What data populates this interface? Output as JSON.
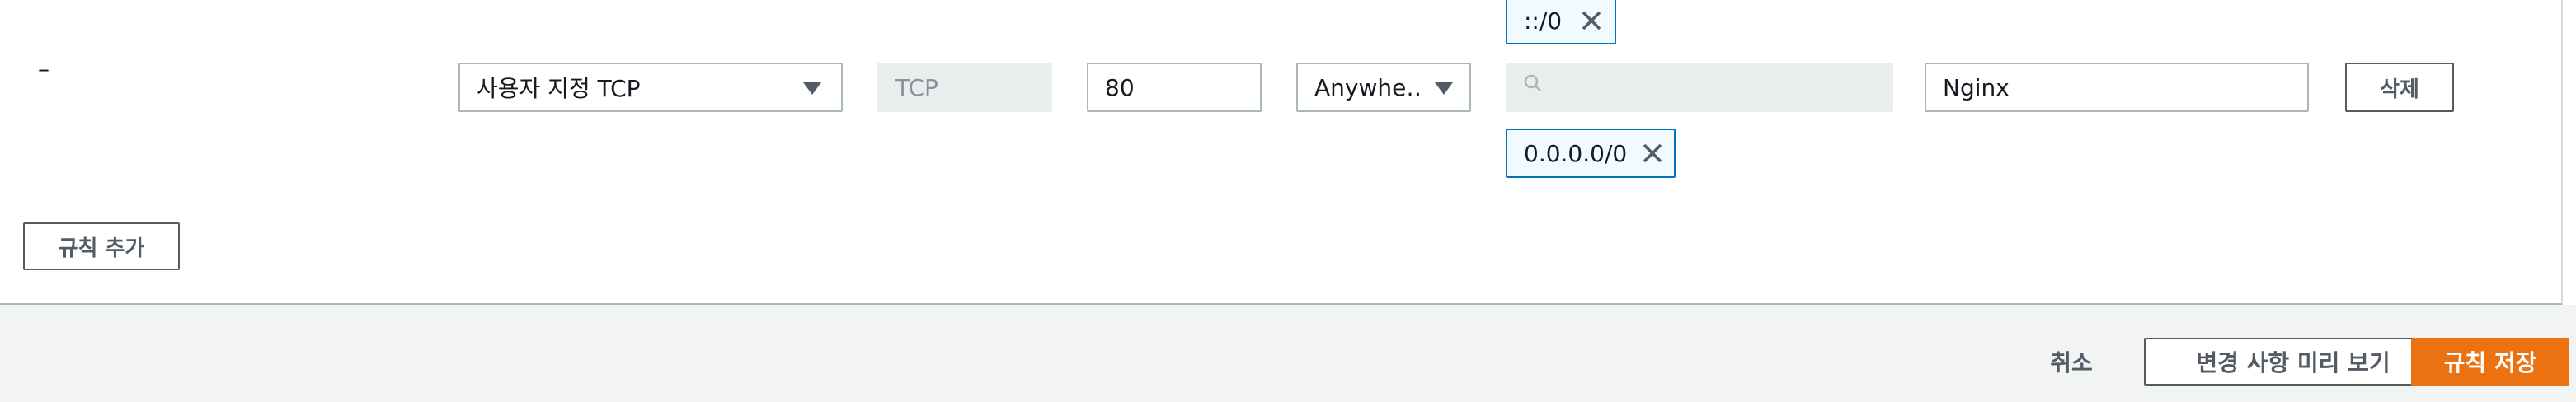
{
  "row": {
    "dash": "–",
    "type_select": "사용자 지정 TCP",
    "protocol_field": "TCP",
    "port_input": "80",
    "source_select": "Anywhe…",
    "search_placeholder": "",
    "tokens": [
      "::/0",
      "0.0.0.0/0"
    ],
    "description_input": "Nginx",
    "delete_label": "삭제"
  },
  "add_rule_label": "규칙 추가",
  "footer": {
    "cancel_label": "취소",
    "preview_label": "변경 사항 미리 보기",
    "save_label": "규칙 저장"
  },
  "icons": {
    "caret": "caret-down-icon",
    "search": "search-icon",
    "remove": "close-icon"
  },
  "colors": {
    "primary": "#ec7211",
    "token_border": "#0073bb",
    "token_bg": "#f1faff"
  }
}
